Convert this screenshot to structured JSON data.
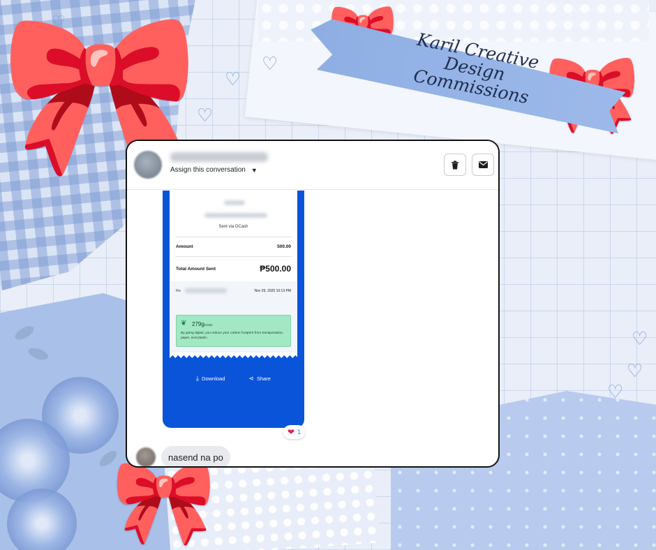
{
  "banner": {
    "line1": "Karil Creative Design",
    "line2": "Commissions"
  },
  "header": {
    "assign_label": "Assign this conversation",
    "delete_icon": "trash-icon",
    "mail_icon": "envelope-icon"
  },
  "receipt": {
    "sent_via": "Sent via GCash",
    "amount_label": "Amount",
    "amount_value": "500.00",
    "total_label": "Total Amount Sent",
    "total_value": "₱500.00",
    "ref_label": "Re",
    "date": "Nov 29, 2025 10:13 PM",
    "eco_value": "279g",
    "eco_unit": "CO2e",
    "eco_text": "By going digital, you reduce your carbon footprint from transportation, paper, and plastic.",
    "download_label": "Download",
    "share_label": "Share"
  },
  "reaction": {
    "emoji": "❤",
    "count": "1"
  },
  "message": {
    "text": "nasend na po"
  },
  "colors": {
    "gcash_blue": "#0a54d9",
    "eco_green": "#a2e8c4",
    "bubble_gray": "#e9eaee"
  }
}
